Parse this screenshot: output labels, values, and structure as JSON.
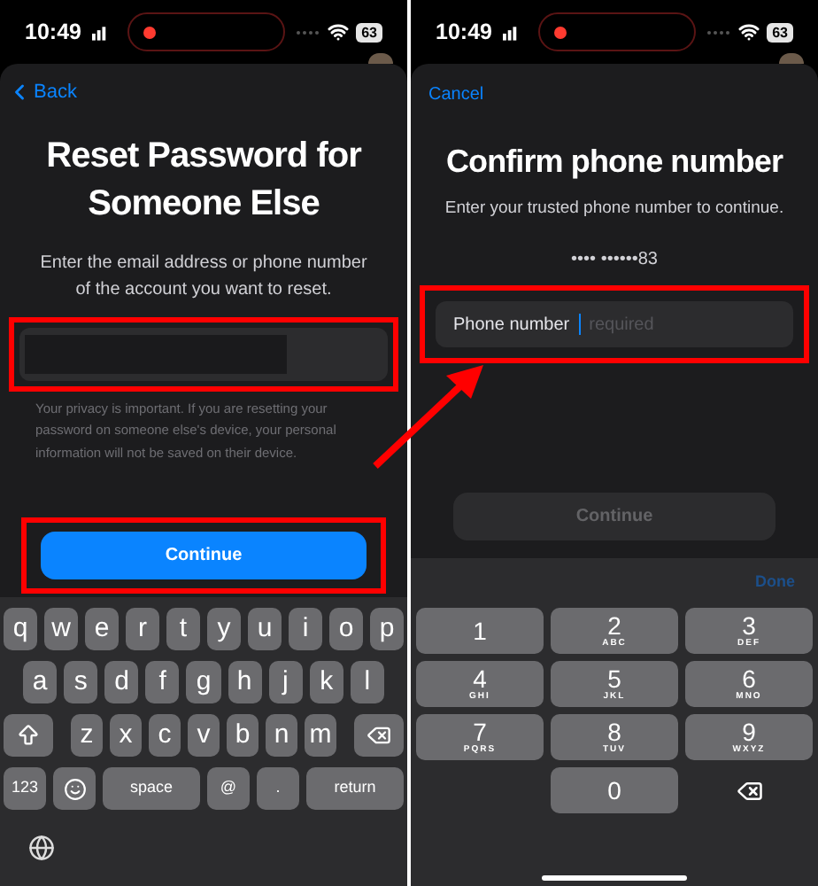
{
  "left_screen": {
    "status_bar": {
      "time": "10:49",
      "battery": "63"
    },
    "back": "Back",
    "title": "Reset Password for Someone Else",
    "subtitle": "Enter the email address or phone number of the account you want to reset.",
    "field": {
      "highlighted": true
    },
    "note": "Your privacy is important. If you are resetting your password on someone else's device, your personal information will not be saved on their device.",
    "continue": {
      "label": "Continue",
      "disabled": false,
      "highlighted": true
    },
    "keyboard": {
      "letter_rows": [
        [
          "q",
          "w",
          "e",
          "r",
          "t",
          "y",
          "u",
          "i",
          "o",
          "p"
        ],
        [
          "a",
          "s",
          "d",
          "f",
          "g",
          "h",
          "j",
          "k",
          "l"
        ],
        [
          "z",
          "x",
          "c",
          "v",
          "b",
          "n",
          "m"
        ]
      ],
      "bottom_row": [
        {
          "kind": "key",
          "label": "123"
        },
        {
          "kind": "emoji"
        },
        {
          "kind": "wide",
          "label": "space"
        },
        {
          "kind": "key",
          "label": "@"
        },
        {
          "kind": "key",
          "label": "."
        },
        {
          "kind": "wide",
          "label": "return"
        }
      ]
    }
  },
  "right_screen": {
    "status_bar": {
      "time": "10:49",
      "battery": "63"
    },
    "cancel": "Cancel",
    "title": "Confirm phone number",
    "subtitle": "Enter your trusted phone number to continue.",
    "masked_number": "•••• ••••••83",
    "field": {
      "label": "Phone number",
      "placeholder": "required",
      "highlighted": true
    },
    "continue": {
      "label": "Continue",
      "disabled": true
    },
    "done": "Done",
    "keypad": [
      {
        "kind": "digit",
        "digit": "1"
      },
      {
        "kind": "digit",
        "digit": "2",
        "letters": "ABC"
      },
      {
        "kind": "digit",
        "digit": "3",
        "letters": "DEF"
      },
      {
        "kind": "digit",
        "digit": "4",
        "letters": "GHI"
      },
      {
        "kind": "digit",
        "digit": "5",
        "letters": "JKL"
      },
      {
        "kind": "digit",
        "digit": "6",
        "letters": "MNO"
      },
      {
        "kind": "digit",
        "digit": "7",
        "letters": "PQRS"
      },
      {
        "kind": "digit",
        "digit": "8",
        "letters": "TUV"
      },
      {
        "kind": "digit",
        "digit": "9",
        "letters": "WXYZ"
      },
      {
        "kind": "blank"
      },
      {
        "kind": "digit",
        "digit": "0"
      },
      {
        "kind": "delete"
      }
    ]
  }
}
